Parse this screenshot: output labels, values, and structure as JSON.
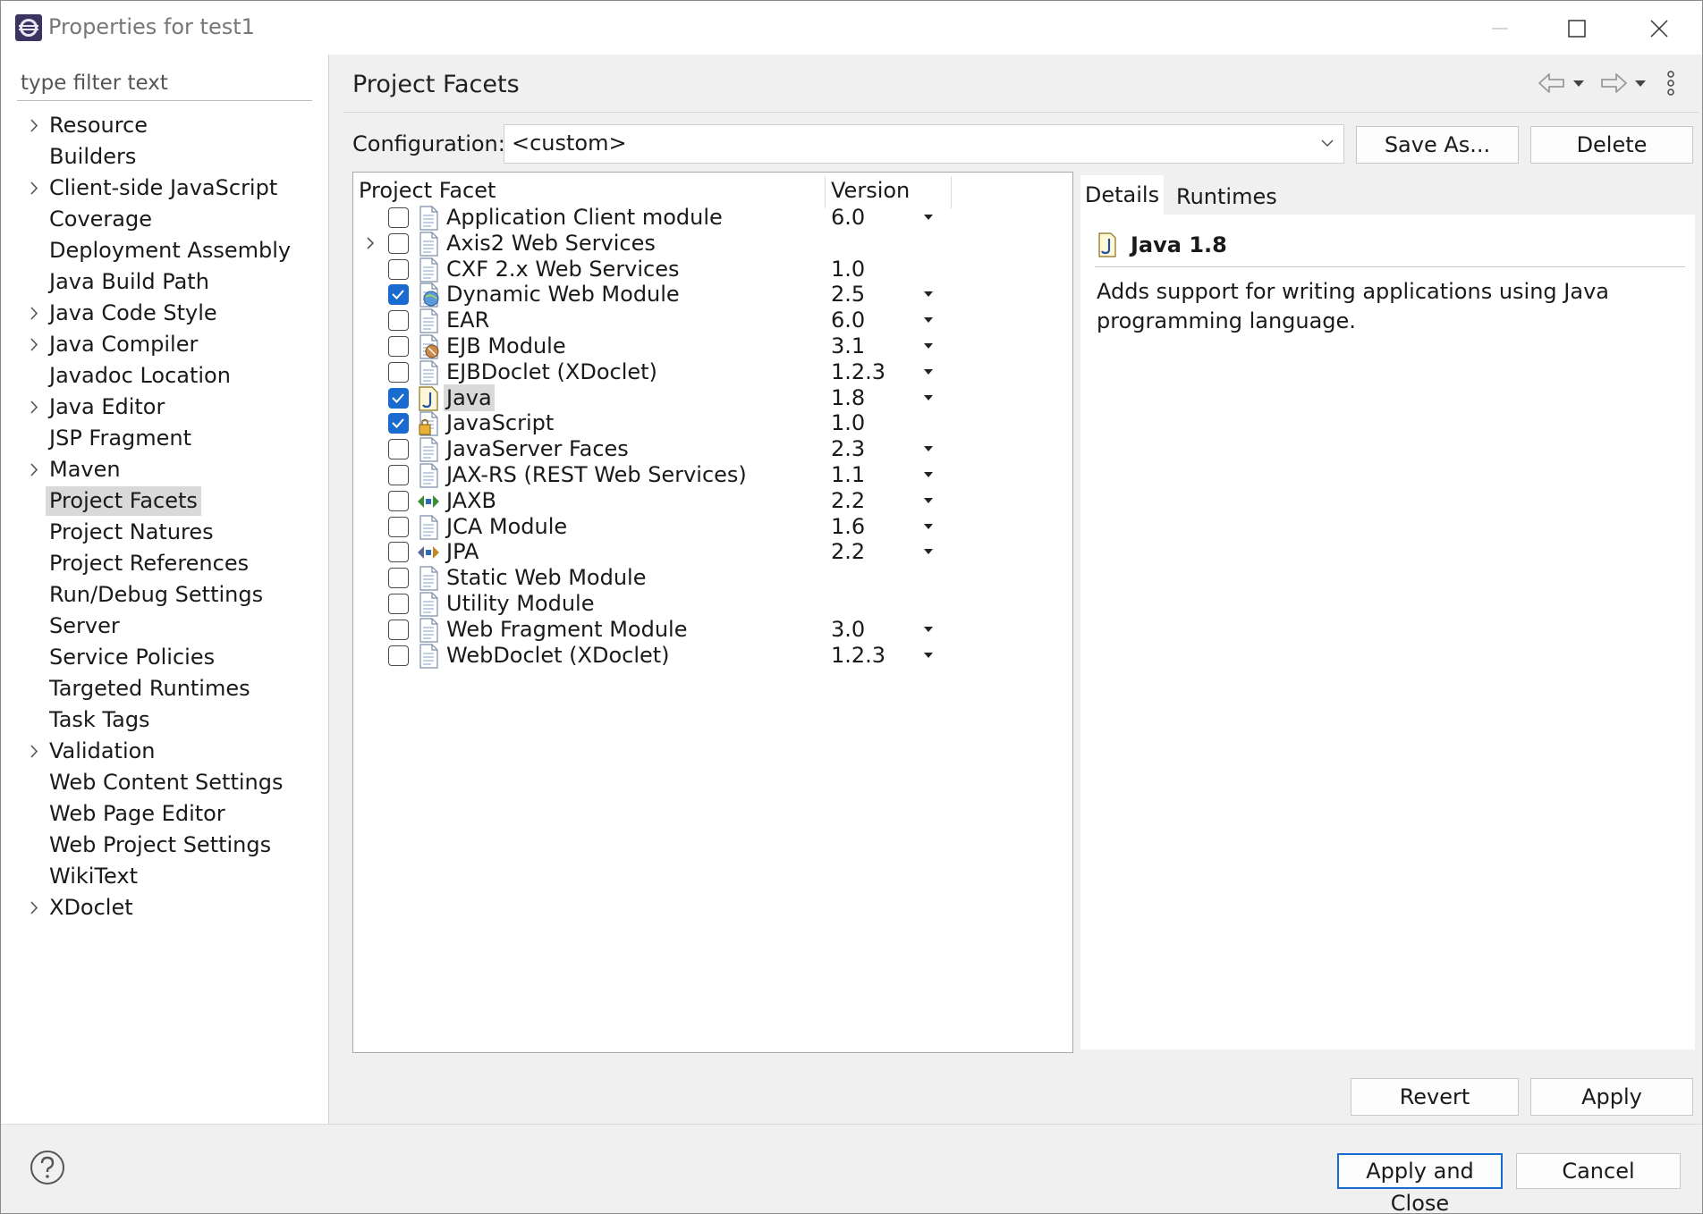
{
  "window": {
    "title": "Properties for test1"
  },
  "sidebar": {
    "filter_placeholder": "type filter text",
    "items": [
      {
        "label": "Resource",
        "expandable": true
      },
      {
        "label": "Builders",
        "expandable": false
      },
      {
        "label": "Client-side JavaScript",
        "expandable": true
      },
      {
        "label": "Coverage",
        "expandable": false
      },
      {
        "label": "Deployment Assembly",
        "expandable": false
      },
      {
        "label": "Java Build Path",
        "expandable": false
      },
      {
        "label": "Java Code Style",
        "expandable": true
      },
      {
        "label": "Java Compiler",
        "expandable": true
      },
      {
        "label": "Javadoc Location",
        "expandable": false
      },
      {
        "label": "Java Editor",
        "expandable": true
      },
      {
        "label": "JSP Fragment",
        "expandable": false
      },
      {
        "label": "Maven",
        "expandable": true
      },
      {
        "label": "Project Facets",
        "expandable": false,
        "selected": true
      },
      {
        "label": "Project Natures",
        "expandable": false
      },
      {
        "label": "Project References",
        "expandable": false
      },
      {
        "label": "Run/Debug Settings",
        "expandable": false
      },
      {
        "label": "Server",
        "expandable": false
      },
      {
        "label": "Service Policies",
        "expandable": false
      },
      {
        "label": "Targeted Runtimes",
        "expandable": false
      },
      {
        "label": "Task Tags",
        "expandable": false
      },
      {
        "label": "Validation",
        "expandable": true
      },
      {
        "label": "Web Content Settings",
        "expandable": false
      },
      {
        "label": "Web Page Editor",
        "expandable": false
      },
      {
        "label": "Web Project Settings",
        "expandable": false
      },
      {
        "label": "WikiText",
        "expandable": false
      },
      {
        "label": "XDoclet",
        "expandable": true
      }
    ]
  },
  "main": {
    "title": "Project Facets",
    "configuration": {
      "label": "Configuration:",
      "value": "<custom>"
    },
    "buttons": {
      "save_as": "Save As...",
      "delete": "Delete",
      "revert": "Revert",
      "apply": "Apply"
    },
    "table": {
      "col_facet": "Project Facet",
      "col_version": "Version",
      "rows": [
        {
          "name": "Application Client module",
          "version": "6.0",
          "checked": false,
          "dropdown": true,
          "icon": "page-icon"
        },
        {
          "name": "Axis2 Web Services",
          "version": "",
          "checked": false,
          "dropdown": false,
          "icon": "page-icon",
          "expandable": true
        },
        {
          "name": "CXF 2.x Web Services",
          "version": "1.0",
          "checked": false,
          "dropdown": false,
          "icon": "page-icon"
        },
        {
          "name": "Dynamic Web Module",
          "version": "2.5",
          "checked": true,
          "dropdown": true,
          "icon": "web-module-icon"
        },
        {
          "name": "EAR",
          "version": "6.0",
          "checked": false,
          "dropdown": true,
          "icon": "page-icon"
        },
        {
          "name": "EJB Module",
          "version": "3.1",
          "checked": false,
          "dropdown": true,
          "icon": "ejb-icon"
        },
        {
          "name": "EJBDoclet (XDoclet)",
          "version": "1.2.3",
          "checked": false,
          "dropdown": true,
          "icon": "page-icon"
        },
        {
          "name": "Java",
          "version": "1.8",
          "checked": true,
          "dropdown": true,
          "icon": "java-icon",
          "selected": true
        },
        {
          "name": "JavaScript",
          "version": "1.0",
          "checked": true,
          "dropdown": false,
          "icon": "javascript-icon"
        },
        {
          "name": "JavaServer Faces",
          "version": "2.3",
          "checked": false,
          "dropdown": true,
          "icon": "page-icon"
        },
        {
          "name": "JAX-RS (REST Web Services)",
          "version": "1.1",
          "checked": false,
          "dropdown": true,
          "icon": "page-icon"
        },
        {
          "name": "JAXB",
          "version": "2.2",
          "checked": false,
          "dropdown": true,
          "icon": "jaxb-icon"
        },
        {
          "name": "JCA Module",
          "version": "1.6",
          "checked": false,
          "dropdown": true,
          "icon": "page-icon"
        },
        {
          "name": "JPA",
          "version": "2.2",
          "checked": false,
          "dropdown": true,
          "icon": "jpa-icon"
        },
        {
          "name": "Static Web Module",
          "version": "",
          "checked": false,
          "dropdown": false,
          "icon": "page-icon"
        },
        {
          "name": "Utility Module",
          "version": "",
          "checked": false,
          "dropdown": false,
          "icon": "page-icon"
        },
        {
          "name": "Web Fragment Module",
          "version": "3.0",
          "checked": false,
          "dropdown": true,
          "icon": "page-icon"
        },
        {
          "name": "WebDoclet (XDoclet)",
          "version": "1.2.3",
          "checked": false,
          "dropdown": true,
          "icon": "page-icon"
        }
      ]
    },
    "details": {
      "tabs": [
        "Details",
        "Runtimes"
      ],
      "active_tab": "Details",
      "title": "Java 1.8",
      "description": "Adds support for writing applications using Java programming language."
    }
  },
  "footer": {
    "apply_close": "Apply and Close",
    "cancel": "Cancel"
  },
  "colors": {
    "accent": "#1a6bd0",
    "selection": "#d9d9d9",
    "background": "#f0f0f0"
  }
}
